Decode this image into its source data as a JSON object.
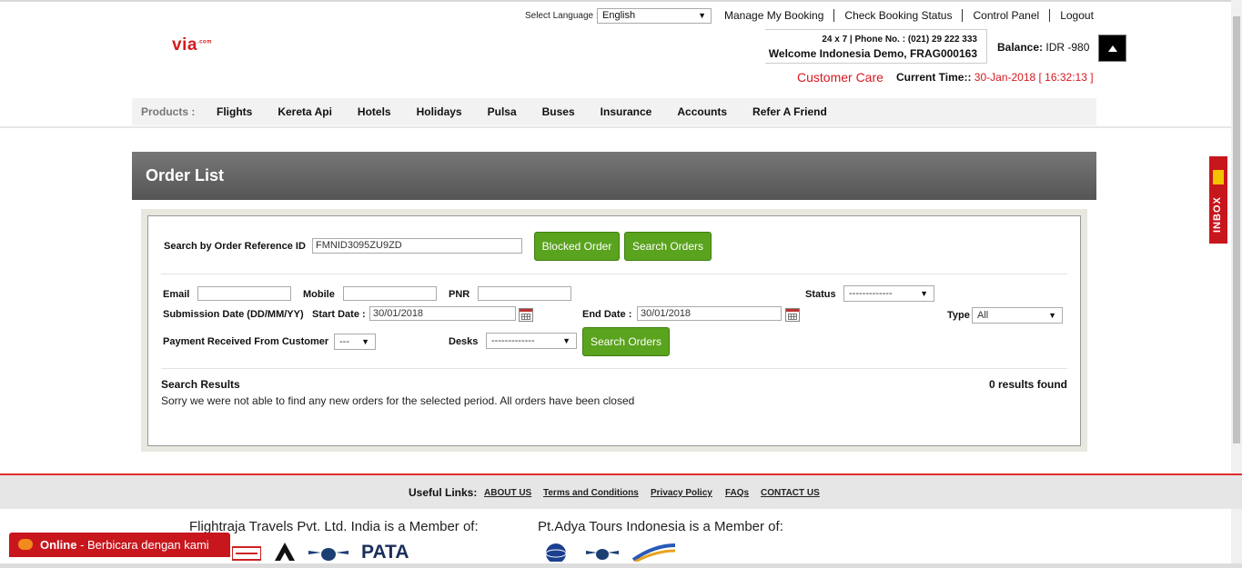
{
  "header": {
    "logo": "via",
    "logo_sup": ".com",
    "language_label": "Select Language :",
    "language_value": "English",
    "top_links": [
      "Manage My Booking",
      "Check Booking Status",
      "Control Panel",
      "Logout"
    ],
    "phone": "24 x 7 | Phone No. : (021) 29 222 333",
    "welcome": "Welcome Indonesia Demo, FRAG000163",
    "balance_label": "Balance:",
    "balance_value": "IDR -980",
    "customer_care": "Customer Care",
    "current_time_label": "Current Time::",
    "current_time_value": "30-Jan-2018 [ 16:32:13 ]"
  },
  "nav": {
    "label": "Products :",
    "items": [
      "Flights",
      "Kereta Api",
      "Hotels",
      "Holidays",
      "Pulsa",
      "Buses",
      "Insurance",
      "Accounts",
      "Refer A Friend"
    ]
  },
  "inbox": "INBOX",
  "page_title": "Order List",
  "search": {
    "order_ref_label": "Search by Order Reference ID",
    "order_ref_value": "FMNID3095ZU9ZD",
    "blocked_order": "Blocked Order",
    "search_orders": "Search Orders",
    "email_label": "Email",
    "mobile_label": "Mobile",
    "pnr_label": "PNR",
    "status_label": "Status",
    "status_value": "-------------",
    "submission_label": "Submission Date (DD/MM/YY)",
    "start_label": "Start Date :",
    "start_value": "30/01/2018",
    "end_label": "End Date :",
    "end_value": "30/01/2018",
    "type_label": "Type",
    "type_value": "All",
    "payment_label": "Payment Received From Customer",
    "payment_value": "---",
    "desks_label": "Desks",
    "desks_value": "-------------",
    "search_orders_2": "Search Orders"
  },
  "results": {
    "title": "Search Results",
    "count": "0 results found",
    "message": "Sorry we were not able to find any new orders for the selected period. All orders have been closed"
  },
  "footer": {
    "useful_links_label": "Useful Links:",
    "links": [
      "ABOUT US",
      "Terms and Conditions",
      "Privacy Policy",
      "FAQs",
      "CONTACT US"
    ],
    "member_india": "Flightraja Travels Pvt. Ltd. India is a Member of:",
    "member_indonesia": "Pt.Adya Tours Indonesia is a Member of:",
    "pata": "PATA"
  },
  "chat": {
    "status": "Online",
    "text": " - Berbicara dengan kami"
  },
  "colors": {
    "brand_red": "#d71920",
    "button_green": "#5aa31e",
    "banner_gray": "#666666"
  }
}
